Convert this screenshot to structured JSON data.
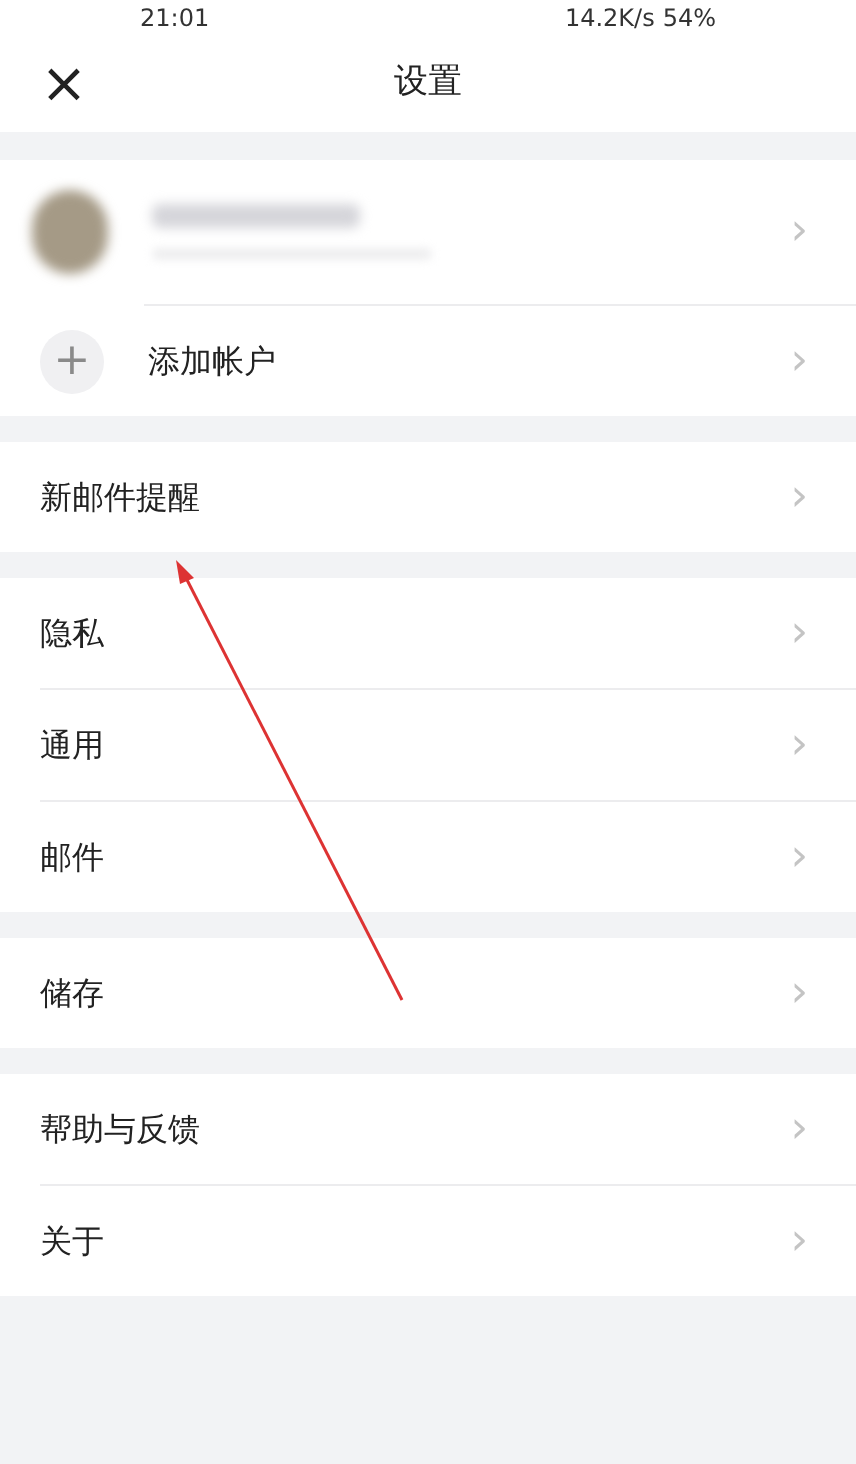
{
  "status_bar": {
    "time": "21:01",
    "speed": "14.2K/s",
    "battery": "54%"
  },
  "header": {
    "close": "×",
    "title": "设置"
  },
  "sections": [
    {
      "items": [
        {
          "kind": "account",
          "chevron": "›"
        },
        {
          "kind": "add",
          "icon": "+",
          "label": "添加帐户",
          "chevron": "›"
        }
      ]
    },
    {
      "items": [
        {
          "kind": "item",
          "label": "新邮件提醒",
          "chevron": "›"
        }
      ]
    },
    {
      "items": [
        {
          "kind": "item",
          "label": "隐私",
          "chevron": "›"
        },
        {
          "kind": "item",
          "label": "通用",
          "chevron": "›"
        },
        {
          "kind": "item",
          "label": "邮件",
          "chevron": "›"
        }
      ]
    },
    {
      "items": [
        {
          "kind": "item",
          "label": "储存",
          "chevron": "›"
        }
      ]
    },
    {
      "items": [
        {
          "kind": "item",
          "label": "帮助与反馈",
          "chevron": "›"
        },
        {
          "kind": "item",
          "label": "关于",
          "chevron": "›"
        }
      ]
    }
  ]
}
